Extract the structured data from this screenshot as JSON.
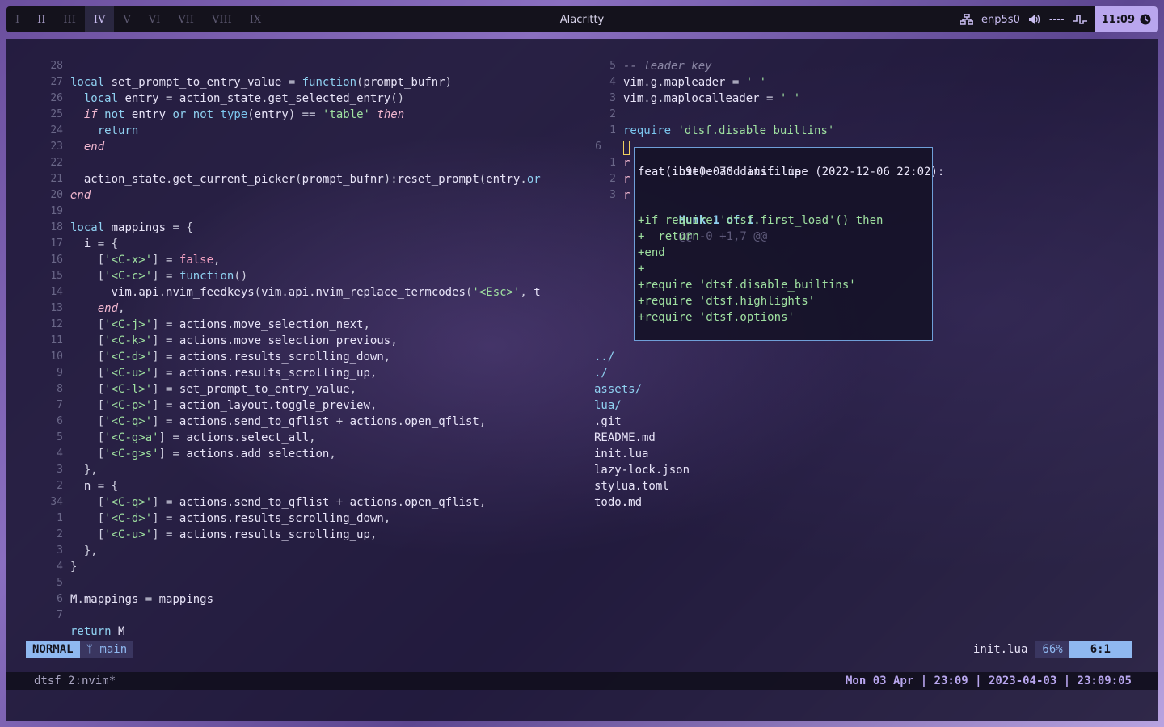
{
  "workspaces": [
    {
      "label": "I",
      "state": "empty"
    },
    {
      "label": "II",
      "state": "occupied"
    },
    {
      "label": "III",
      "state": "empty"
    },
    {
      "label": "IV",
      "state": "active"
    },
    {
      "label": "V",
      "state": "empty"
    },
    {
      "label": "VI",
      "state": "empty"
    },
    {
      "label": "VII",
      "state": "empty"
    },
    {
      "label": "VIII",
      "state": "empty"
    },
    {
      "label": "IX",
      "state": "empty"
    }
  ],
  "window_title": "Alacritty",
  "tray": {
    "network": "enp5s0",
    "volume": "----",
    "clock": "11:09"
  },
  "left_pane": {
    "line_numbers": [
      "28",
      "27",
      "26",
      "25",
      "24",
      "23",
      "22",
      "21",
      "20",
      "19",
      "18",
      "17",
      "16",
      "15",
      "14",
      "13",
      "12",
      "11",
      "10",
      "9",
      "8",
      "7",
      "6",
      "5",
      "4",
      "3",
      "2",
      "34",
      "1",
      "2",
      "3",
      "4",
      "5",
      "6",
      "7"
    ],
    "lines": [
      "",
      "local set_prompt_to_entry_value = function(prompt_bufnr)",
      "  local entry = action_state.get_selected_entry()",
      "  if not entry or not type(entry) == 'table' then",
      "    return",
      "  end",
      "",
      "  action_state.get_current_picker(prompt_bufnr):reset_prompt(entry.or",
      "end",
      "",
      "local mappings = {",
      "  i = {",
      "    ['<C-x>'] = false,",
      "    ['<C-c>'] = function()",
      "      vim.api.nvim_feedkeys(vim.api.nvim_replace_termcodes('<Esc>', t",
      "    end,",
      "    ['<C-j>'] = actions.move_selection_next,",
      "    ['<C-k>'] = actions.move_selection_previous,",
      "    ['<C-d>'] = actions.results_scrolling_down,",
      "    ['<C-u>'] = actions.results_scrolling_up,",
      "    ['<C-l>'] = set_prompt_to_entry_value,",
      "    ['<C-p>'] = action_layout.toggle_preview,",
      "    ['<C-q>'] = actions.send_to_qflist + actions.open_qflist,",
      "    ['<C-g>a'] = actions.select_all,",
      "    ['<C-g>s'] = actions.add_selection,",
      "  },",
      "  n = {",
      "    ['<C-q>'] = actions.send_to_qflist + actions.open_qflist,",
      "    ['<C-d>'] = actions.results_scrolling_down,",
      "    ['<C-u>'] = actions.results_scrolling_up,",
      "  },",
      "}",
      "",
      "M.mappings = mappings",
      "",
      "return M"
    ]
  },
  "right_pane": {
    "top_line_numbers": [
      "5",
      "4",
      "3",
      "2",
      "1",
      "6",
      "1",
      "2",
      "3"
    ],
    "top_lines": [
      "-- leader key",
      "vim.g.mapleader = ' '",
      "vim.g.maplocalleader = ' '",
      "",
      "require 'dtsf.disable_builtins'",
      "",
      "r",
      "r",
      "r"
    ],
    "blame_popup": {
      "header": "b9e0e070 datsfilipe (2022-12-06 22:02):",
      "message": "feat(init): add init.lua",
      "hunk_label": "Hunk 1 of 1",
      "hunk_range": "@@ -0 +1,7 @@",
      "diff": [
        "+if require 'dtsf.first_load'() then",
        "+  return",
        "+end",
        "+",
        "+require 'dtsf.disable_builtins'",
        "+require 'dtsf.highlights'",
        "+require 'dtsf.options'"
      ]
    },
    "files": [
      "../",
      "./",
      "assets/",
      "lua/",
      ".git",
      "README.md",
      "init.lua",
      "lazy-lock.json",
      "stylua.toml",
      "todo.md"
    ]
  },
  "statusline": {
    "mode": "NORMAL",
    "branch": "main",
    "filename": "init.lua",
    "percent": "66%",
    "position": "6:1"
  },
  "tmux": {
    "left": "dtsf 2:nvim*",
    "right": "Mon 03 Apr  |  23:09  |  2023-04-03  |  23:09:05"
  }
}
